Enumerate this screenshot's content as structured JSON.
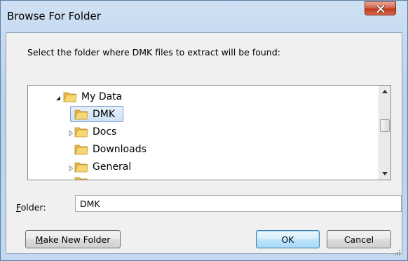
{
  "window": {
    "title": "Browse For Folder",
    "close_icon": "close-icon"
  },
  "dialog": {
    "instruction": "Select the folder where DMK files to extract will be found:"
  },
  "tree": {
    "items": [
      {
        "label": "My Data",
        "expanded": true,
        "level": 0,
        "selected": false
      },
      {
        "label": "DMK",
        "expanded": null,
        "level": 1,
        "selected": true
      },
      {
        "label": "Docs",
        "expanded": false,
        "level": 1,
        "selected": false
      },
      {
        "label": "Downloads",
        "expanded": null,
        "level": 1,
        "selected": false
      },
      {
        "label": "General",
        "expanded": false,
        "level": 1,
        "selected": false
      }
    ]
  },
  "folder": {
    "label_accel": "F",
    "label_rest": "older:",
    "value": "DMK"
  },
  "buttons": {
    "make_new_accel": "M",
    "make_new_rest": "ake New Folder",
    "ok": "OK",
    "cancel": "Cancel"
  },
  "colors": {
    "selection_border": "#7da2ce",
    "default_button_border": "#3c7fb1",
    "close_button": "#c4391c"
  }
}
